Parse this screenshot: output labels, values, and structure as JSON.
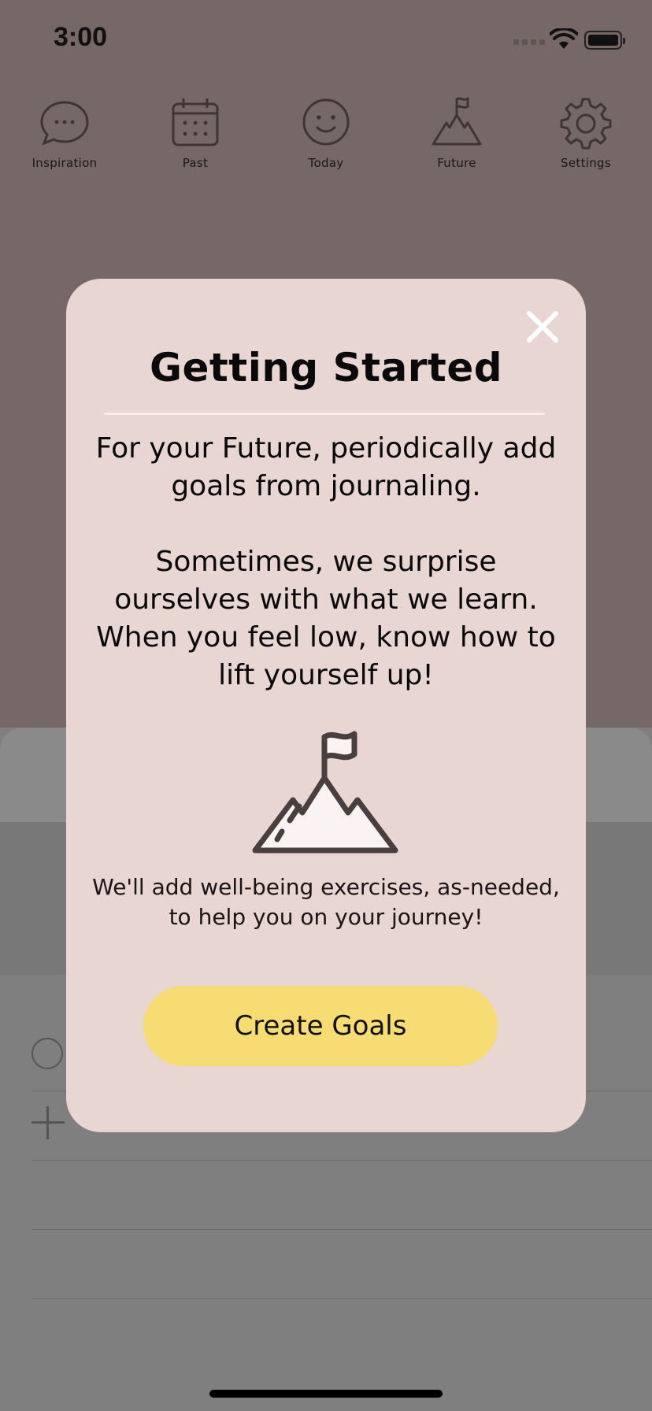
{
  "status_bar": {
    "time": "3:00",
    "icons": [
      "cellular-signal-icon",
      "wifi-icon",
      "battery-icon"
    ]
  },
  "nav": {
    "items": [
      {
        "label": "Inspiration",
        "icon": "speech-bubble-icon"
      },
      {
        "label": "Past",
        "icon": "calendar-icon"
      },
      {
        "label": "Today",
        "icon": "smiley-icon"
      },
      {
        "label": "Future",
        "icon": "mountain-flag-icon"
      },
      {
        "label": "Settings",
        "icon": "gear-icon"
      }
    ]
  },
  "modal": {
    "title": "Getting Started",
    "body_paragraph_1": "For your Future, periodically add goals from journaling.",
    "body_paragraph_2": "Sometimes, we surprise ourselves with what we learn. When you feel low, know how to lift yourself up!",
    "illustration": "mountain-flag-icon",
    "note": "We'll add well-being exercises, as-needed, to help you on your journey!",
    "primary_button": "Create Goals",
    "close_icon": "close-icon"
  },
  "colors": {
    "modal_background": "#e8d6d2",
    "button_yellow": "#f6dc72",
    "overlay_top": "#756866",
    "icon_stroke": "#4a3f3f"
  }
}
